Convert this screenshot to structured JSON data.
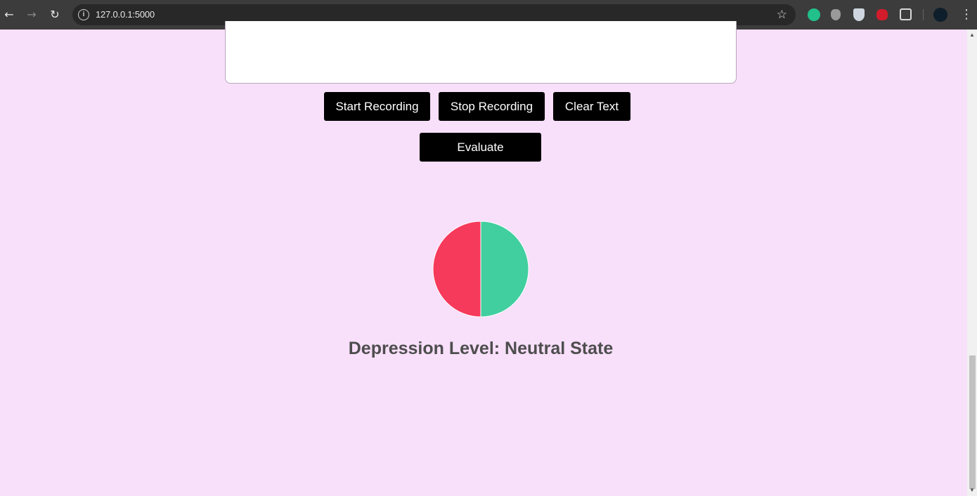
{
  "browser": {
    "url": "127.0.0.1:5000"
  },
  "controls": {
    "start_label": "Start Recording",
    "stop_label": "Stop Recording",
    "clear_label": "Clear Text",
    "evaluate_label": "Evaluate"
  },
  "chart_data": {
    "type": "pie",
    "title": "",
    "labels": [],
    "values": [
      50,
      50
    ],
    "colors": [
      "#41cf9f",
      "#f63a5b"
    ],
    "legend": "none"
  },
  "result": {
    "text": "Depression Level: Neutral State"
  },
  "colors": {
    "page_background": "#f8dffa",
    "button_background": "#000000",
    "result_text": "#4d4d4d"
  }
}
